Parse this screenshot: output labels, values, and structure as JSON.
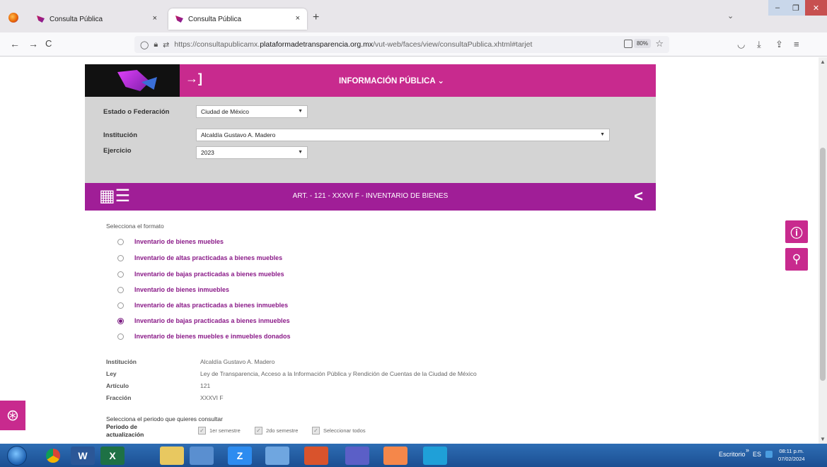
{
  "browser": {
    "tabs": [
      {
        "label": "Consulta Pública",
        "close": "×"
      },
      {
        "label": "Consulta Pública",
        "close": "×"
      }
    ],
    "new_tab": "+",
    "tab_list": "⌄",
    "window_controls": {
      "minimize": "–",
      "maximize": "❐",
      "close": "✕"
    },
    "back": "←",
    "forward": "→",
    "reload": "C",
    "url_prefix": "https://consultapublicamx.",
    "url_domain": "plataformadetransparencia.org.mx",
    "url_suffix": "/vut-web/faces/view/consultaPublica.xhtml#tarjet",
    "zoom": "80%"
  },
  "banner": {
    "login_icon": "→]",
    "title": "INFORMACIÓN PÚBLICA ⌄"
  },
  "filters": {
    "estado_label": "Estado o Federación",
    "estado_value": "Ciudad de México",
    "institucion_label": "Institución",
    "institucion_value": "Alcaldía Gustavo A. Madero",
    "ejercicio_label": "Ejercicio",
    "ejercicio_value": "2023"
  },
  "article": {
    "title": "ART. - 121 - XXXVI F - INVENTARIO DE BIENES",
    "icon": "table-icon",
    "share_icon": "share-icon"
  },
  "formats": {
    "label": "Selecciona el formato",
    "options": [
      {
        "label": "Inventario de bienes muebles",
        "selected": false
      },
      {
        "label": "Inventario de altas practicadas a bienes muebles",
        "selected": false
      },
      {
        "label": "Inventario de bajas practicadas a bienes muebles",
        "selected": false
      },
      {
        "label": "Inventario de bienes inmuebles",
        "selected": false
      },
      {
        "label": "Inventario de altas practicadas a bienes inmuebles",
        "selected": false
      },
      {
        "label": "Inventario de bajas practicadas a bienes inmuebles",
        "selected": true
      },
      {
        "label": "Inventario de bienes muebles e inmuebles donados",
        "selected": false
      }
    ]
  },
  "info": {
    "institucion_label": "Institución",
    "institucion_value": "Alcaldía Gustavo A. Madero",
    "ley_label": "Ley",
    "ley_value": "Ley de Transparencia, Acceso a la Información Pública y Rendición de Cuentas de la Ciudad de México",
    "articulo_label": "Artículo",
    "articulo_value": "121",
    "fraccion_label": "Fracción",
    "fraccion_value": "XXXVI F"
  },
  "period": {
    "question": "Selecciona el periodo que quieres consultar",
    "label": "Periodo de actualización",
    "options": [
      "1er semestre",
      "2do semestre",
      "Seleccionar todos"
    ]
  },
  "taskbar": {
    "escritorio": "Escritorio",
    "chevron": "»",
    "lang": "ES",
    "time": "08:11 p.m.",
    "date": "07/02/2024",
    "apps": [
      "W",
      "X",
      "Z"
    ]
  },
  "colors": {
    "magenta": "#c82a8e",
    "purple": "#a01e97",
    "link_purple": "#8a1a88"
  }
}
